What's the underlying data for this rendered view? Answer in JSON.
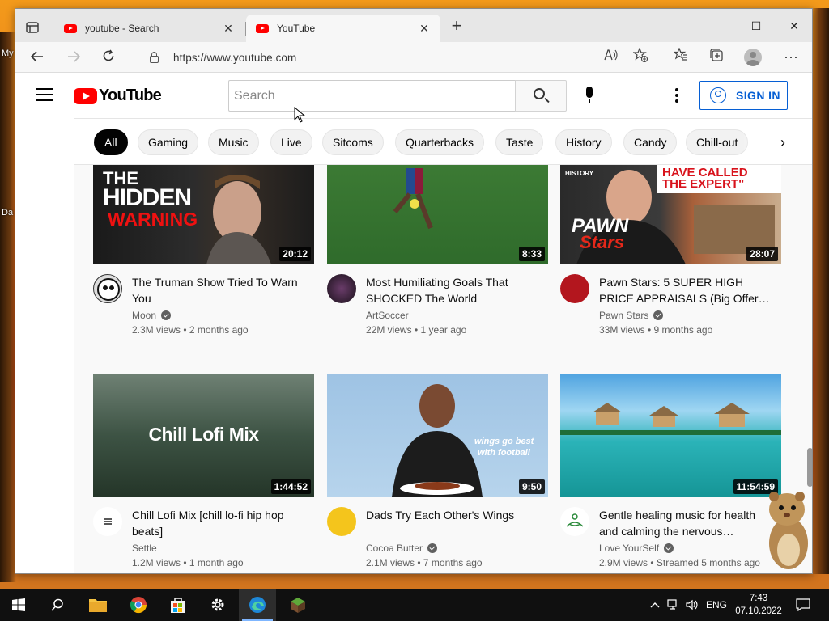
{
  "browser": {
    "tabs": [
      {
        "title": "youtube - Search",
        "active": false
      },
      {
        "title": "YouTube",
        "active": true
      }
    ],
    "url": "https://www.youtube.com"
  },
  "youtube": {
    "logo_text": "YouTube",
    "search_placeholder": "Search",
    "sign_in_label": "SIGN IN",
    "chips": [
      "All",
      "Gaming",
      "Music",
      "Live",
      "Sitcoms",
      "Quarterbacks",
      "Taste",
      "History",
      "Candy",
      "Chill-out"
    ],
    "videos": [
      {
        "title": "The Truman Show Tried To Warn You",
        "channel": "Moon",
        "verified": true,
        "stats": "2.3M views • 2 months ago",
        "duration": "20:12",
        "thumb_text": [
          "THE",
          "HIDDEN",
          "WARNING"
        ]
      },
      {
        "title": "Most Humiliating Goals That SHOCKED The World",
        "channel": "ArtSoccer",
        "verified": false,
        "stats": "22M views • 1 year ago",
        "duration": "8:33"
      },
      {
        "title": "Pawn Stars: 5 SUPER HIGH PRICE APPRAISALS (Big Offer…",
        "channel": "Pawn Stars",
        "verified": true,
        "stats": "33M views • 9 months ago",
        "duration": "28:07",
        "thumb_text": [
          "HISTORY",
          "HAVE CALLED",
          "THE EXPERT\"",
          "PAWN",
          "Stars"
        ]
      },
      {
        "title": "Chill Lofi Mix [chill lo-fi hip hop beats]",
        "channel": "Settle",
        "verified": false,
        "stats": "1.2M views • 1 month ago",
        "duration": "1:44:52",
        "thumb_text": [
          "Chill Lofi Mix"
        ]
      },
      {
        "title": "Dads Try Each Other's Wings",
        "channel": "Cocoa Butter",
        "verified": true,
        "stats": "2.1M views • 7 months ago",
        "duration": "9:50",
        "thumb_text": [
          "wings go best",
          "with football"
        ]
      },
      {
        "title": "Gentle healing music for health and calming the nervous…",
        "channel": "Love YourSelf",
        "verified": true,
        "stats": "2.9M views • Streamed 5 months ago",
        "duration": "11:54:59"
      }
    ]
  },
  "desktop": {
    "labels": [
      "My",
      "Da"
    ]
  },
  "taskbar": {
    "language": "ENG",
    "time": "7:43",
    "date": "07.10.2022"
  }
}
